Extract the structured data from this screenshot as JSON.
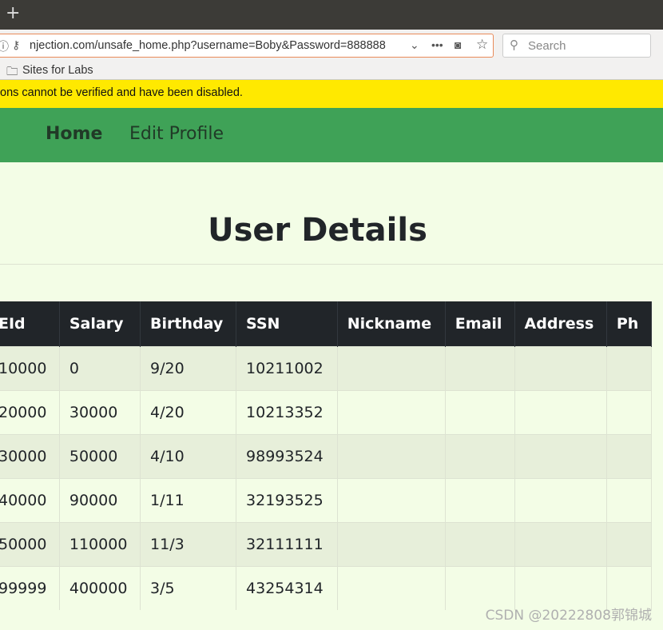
{
  "browser": {
    "url": "njection.com/unsafe_home.php?username=Boby&Password=888888",
    "search_placeholder": "Search",
    "bookmark": "Sites for Labs",
    "warning": "ons cannot be verified and have been disabled."
  },
  "nav": {
    "home": "Home",
    "edit_profile": "Edit Profile"
  },
  "page": {
    "title": "User Details"
  },
  "table": {
    "headers": [
      "EId",
      "Salary",
      "Birthday",
      "SSN",
      "Nickname",
      "Email",
      "Address",
      "Ph"
    ],
    "rows": [
      [
        "10000",
        "0",
        "9/20",
        "10211002"
      ],
      [
        "20000",
        "30000",
        "4/20",
        "10213352"
      ],
      [
        "30000",
        "50000",
        "4/10",
        "98993524"
      ],
      [
        "40000",
        "90000",
        "1/11",
        "32193525"
      ],
      [
        "50000",
        "110000",
        "11/3",
        "32111111"
      ],
      [
        "99999",
        "400000",
        "3/5",
        "43254314"
      ]
    ]
  },
  "watermark": "CSDN @20222808郭锦城"
}
